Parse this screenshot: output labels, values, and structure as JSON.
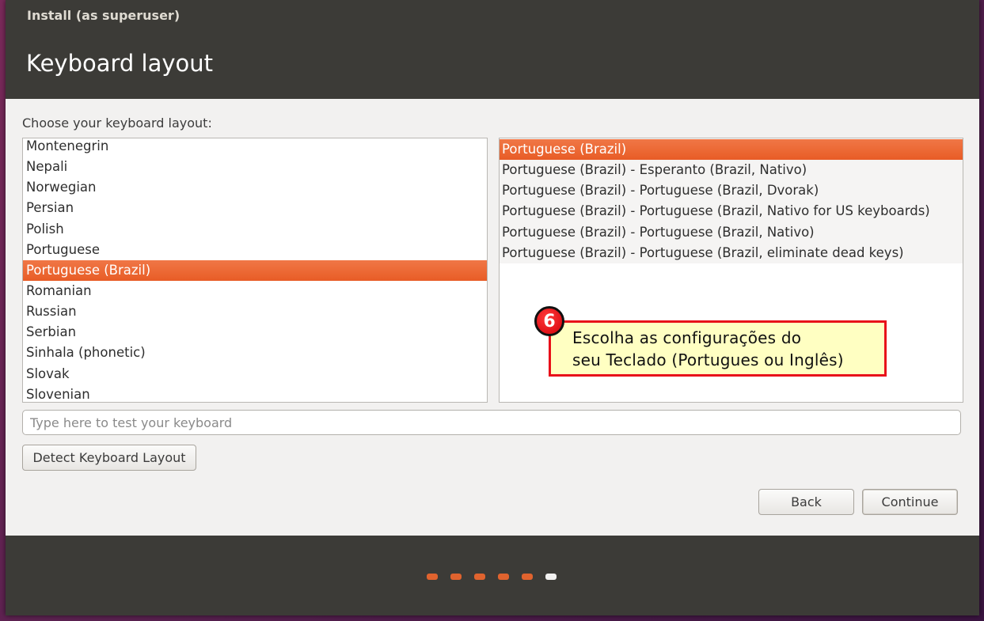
{
  "window": {
    "title": "Install (as superuser)"
  },
  "page": {
    "heading": "Keyboard layout"
  },
  "layout_chooser": {
    "prompt": "Choose your keyboard layout:",
    "layouts": [
      "Montenegrin",
      "Nepali",
      "Norwegian",
      "Persian",
      "Polish",
      "Portuguese",
      "Portuguese (Brazil)",
      "Romanian",
      "Russian",
      "Serbian",
      "Sinhala (phonetic)",
      "Slovak",
      "Slovenian"
    ],
    "selected_layout": "Portuguese (Brazil)",
    "variants": [
      "Portuguese (Brazil)",
      "Portuguese (Brazil) - Esperanto (Brazil, Nativo)",
      "Portuguese (Brazil) - Portuguese (Brazil, Dvorak)",
      "Portuguese (Brazil) - Portuguese (Brazil, Nativo for US keyboards)",
      "Portuguese (Brazil) - Portuguese (Brazil, Nativo)",
      "Portuguese (Brazil) - Portuguese (Brazil, eliminate dead keys)"
    ],
    "selected_variant": "Portuguese (Brazil)"
  },
  "test_field": {
    "placeholder": "Type here to test your keyboard",
    "value": ""
  },
  "buttons": {
    "detect": "Detect Keyboard Layout",
    "back": "Back",
    "continue": "Continue"
  },
  "progress": {
    "total_steps": 6,
    "current_step": 6
  },
  "annotation": {
    "number": "6",
    "line1": "Escolha as configurações do",
    "line2": "seu Teclado (Portugues ou Inglês)"
  },
  "colors": {
    "accent": "#e85c26",
    "titlebar": "#3c3b37",
    "callout_border": "#e8101a",
    "callout_bg": "#ffffc2"
  }
}
